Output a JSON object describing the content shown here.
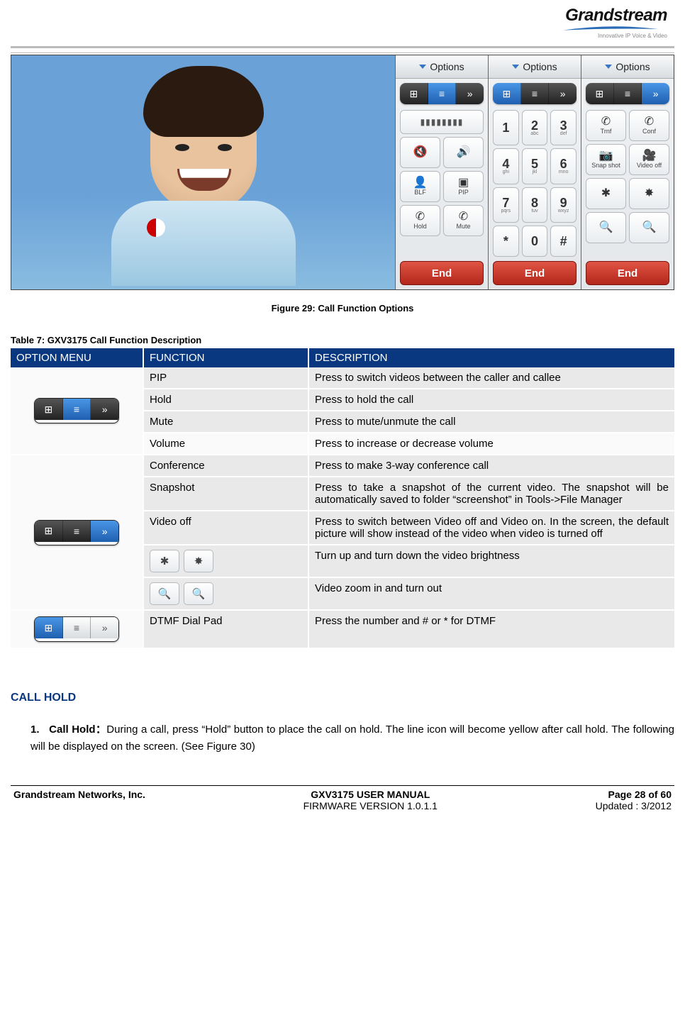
{
  "brand": {
    "name": "Grandstream",
    "tagline": "Innovative IP Voice & Video"
  },
  "figure": {
    "options_label": "Options",
    "end_label": "End",
    "panel2_labels": {
      "blf": "BLF",
      "pip": "PIP",
      "hold": "Hold",
      "mute": "Mute"
    },
    "dialpad": [
      {
        "n": "1",
        "s": ""
      },
      {
        "n": "2",
        "s": "abc"
      },
      {
        "n": "3",
        "s": "def"
      },
      {
        "n": "4",
        "s": "ghi"
      },
      {
        "n": "5",
        "s": "jkl"
      },
      {
        "n": "6",
        "s": "mno"
      },
      {
        "n": "7",
        "s": "pqrs"
      },
      {
        "n": "8",
        "s": "tuv"
      },
      {
        "n": "9",
        "s": "wxyz"
      },
      {
        "n": "*",
        "s": ""
      },
      {
        "n": "0",
        "s": ""
      },
      {
        "n": "#",
        "s": ""
      }
    ],
    "panel4_labels": {
      "trnf": "Trnf",
      "conf": "Conf",
      "snap": "Snap shot",
      "vidoff": "Video off"
    }
  },
  "figure_caption": "Figure 29: Call Function Options",
  "table_caption": "Table 7: GXV3175 Call Function Description",
  "table": {
    "headers": {
      "menu": "OPTION MENU",
      "func": "FUNCTION",
      "desc": "DESCRIPTION"
    },
    "rows": [
      {
        "func": "PIP",
        "desc": "Press to switch videos between the caller and callee"
      },
      {
        "func": "Hold",
        "desc": "Press to hold the call"
      },
      {
        "func": "Mute",
        "desc": "Press to mute/unmute the call"
      },
      {
        "func": "Volume",
        "desc": "Press to increase or decrease volume"
      },
      {
        "func": "Conference",
        "desc": "Press to make 3-way conference call"
      },
      {
        "func": "Snapshot",
        "desc": "Press to take a snapshot of the current video. The snapshot will be automatically saved to folder “screenshot” in Tools->File Manager"
      },
      {
        "func": "Video off",
        "desc": "Press to switch between Video off and Video on. In the screen, the default picture will show instead of the video when video is turned off"
      },
      {
        "func": "",
        "desc": "Turn up and turn down the video brightness"
      },
      {
        "func": "",
        "desc": "Video zoom in and turn out"
      },
      {
        "func": "DTMF Dial Pad",
        "desc": "Press the number and # or * for DTMF"
      }
    ]
  },
  "section_call_hold": {
    "title": "CALL HOLD",
    "item_label": "1.",
    "item_lead": "Call Hold：",
    "item_text": "During a call, press “Hold” button to place the call on hold. The line icon will become yellow after call hold. The following will be displayed on the screen. (See Figure 30)"
  },
  "footer": {
    "company": "Grandstream Networks, Inc.",
    "manual_title": "GXV3175 USER MANUAL",
    "firmware": "FIRMWARE VERSION 1.0.1.1",
    "page": "Page 28 of 60",
    "updated": "Updated : 3/2012"
  }
}
